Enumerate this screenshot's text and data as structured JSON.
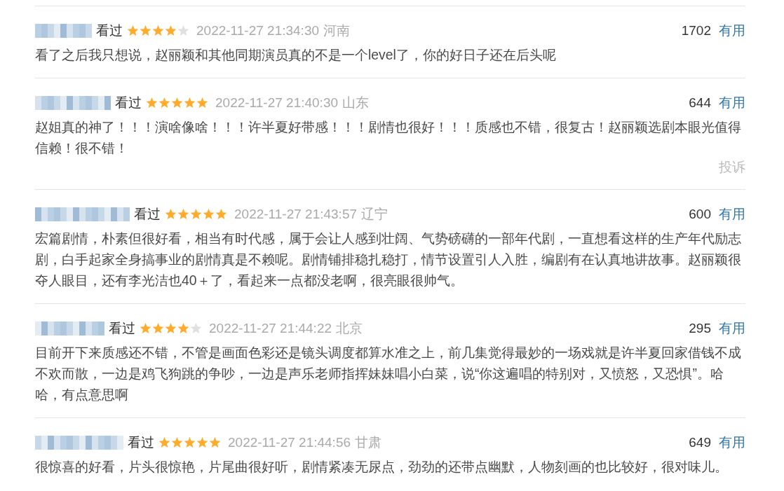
{
  "reviews": [
    {
      "status": "看过",
      "stars": 4,
      "time": "2022-11-27 21:34:30",
      "location": "河南",
      "votes": "1702",
      "vote_label": "有用",
      "text": "看了之后我只想说，赵丽颖和其他同期演员真的不是一个level了，你的好日子还在后头呢"
    },
    {
      "status": "看过",
      "stars": 5,
      "time": "2022-11-27 21:40:30",
      "location": "山东",
      "votes": "644",
      "vote_label": "有用",
      "text": "赵姐真的神了！！！演啥像啥！！！许半夏好带感！！！剧情也很好！！！质感也不错，很复古！赵丽颖选剧本眼光值得信赖！很不错！",
      "report": "投诉"
    },
    {
      "status": "看过",
      "stars": 5,
      "time": "2022-11-27 21:43:57",
      "location": "辽宁",
      "votes": "600",
      "vote_label": "有用",
      "text": "宏篇剧情，朴素但很好看，相当有时代感，属于会让人感到壮阔、气势磅礴的一部年代剧，一直想看这样的生产年代励志剧，白手起家全身搞事业的剧情真是不赖呢。剧情铺排稳扎稳打，情节设置引人入胜，编剧有在认真地讲故事。赵丽颖很夺人眼目，还有李光洁也40＋了，看起来一点都没老啊，很亮眼很帅气。"
    },
    {
      "status": "看过",
      "stars": 4,
      "time": "2022-11-27 21:44:22",
      "location": "北京",
      "votes": "295",
      "vote_label": "有用",
      "text": "目前开下来质感还不错，不管是画面色彩还是镜头调度都算水准之上，前几集觉得最妙的一场戏就是许半夏回家借钱不成不欢而散，一边是鸡飞狗跳的争吵，一边是声乐老师指挥妹妹唱小白菜，说“你这遍唱的特别对，又愤怒，又恐惧”。哈哈，有点意思啊"
    },
    {
      "status": "看过",
      "stars": 5,
      "time": "2022-11-27 21:44:56",
      "location": "甘肃",
      "votes": "649",
      "vote_label": "有用",
      "text": "很惊喜的好看，片头很惊艳，片尾曲很好听，剧情紧凑无尿点，劲劲的还带点幽默，人物刻画的也比较好，很对味儿。"
    }
  ]
}
